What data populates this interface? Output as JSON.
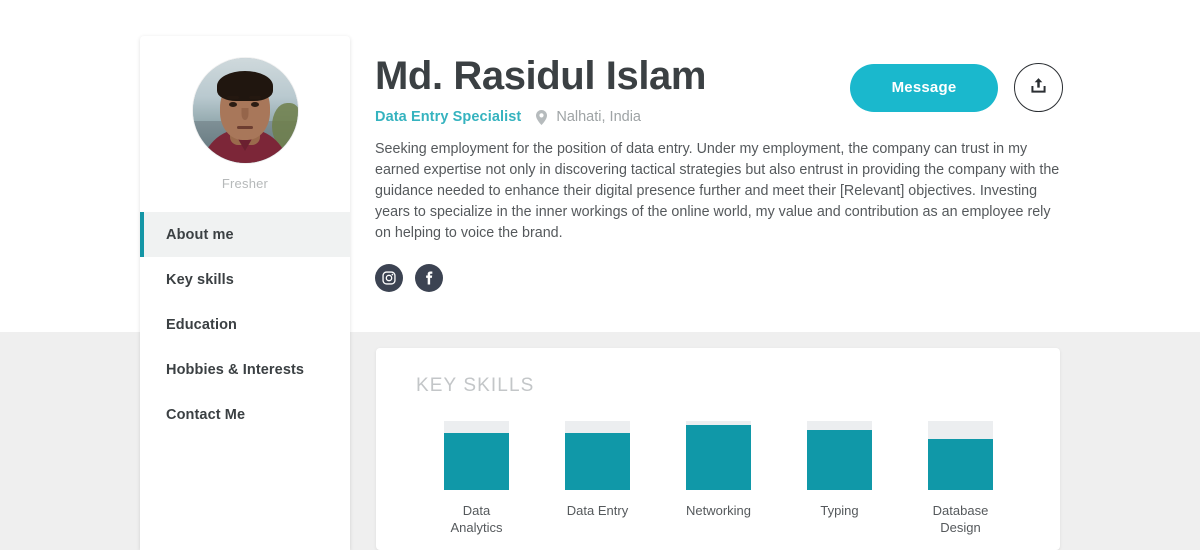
{
  "sidebar": {
    "avatar_alt": "profile-photo",
    "caption": "Fresher",
    "items": [
      {
        "label": "About me",
        "active": true
      },
      {
        "label": "Key skills",
        "active": false
      },
      {
        "label": "Education",
        "active": false
      },
      {
        "label": "Hobbies & Interests",
        "active": false
      },
      {
        "label": "Contact Me",
        "active": false
      }
    ]
  },
  "header": {
    "name": "Md. Rasidul Islam",
    "job_title": "Data Entry Specialist",
    "location": "Nalhati, India",
    "bio": "Seeking employment for the position of data entry. Under my employment, the company can trust in my earned expertise not only in discovering tactical strategies but also entrust in providing the company with the guidance needed to enhance their digital presence further and meet their [Relevant] objectives. Investing years to specialize in the inner workings of the online world, my value and contribution as an employee rely on helping to voice the brand.",
    "socials": [
      {
        "name": "instagram"
      },
      {
        "name": "facebook"
      }
    ]
  },
  "actions": {
    "message_label": "Message",
    "share_label": "Share"
  },
  "skills_section": {
    "title": "KEY SKILLS"
  },
  "colors": {
    "accent_teal": "#1098a8",
    "button_cyan": "#1ab8cd",
    "job_title_teal": "#35b3bf",
    "bar_track": "#eceef0",
    "page_background": "#efefef",
    "social_badge": "#3c4352"
  },
  "chart_data": {
    "type": "bar",
    "title": "KEY SKILLS",
    "categories": [
      "Data Analytics",
      "Data Entry",
      "Networking",
      "Typing",
      "Database Design"
    ],
    "values": [
      83,
      83,
      94,
      87,
      74
    ],
    "xlabel": "",
    "ylabel": "",
    "ylim": [
      0,
      100
    ],
    "grid": false,
    "legend": "none",
    "orientation": "vertical"
  }
}
